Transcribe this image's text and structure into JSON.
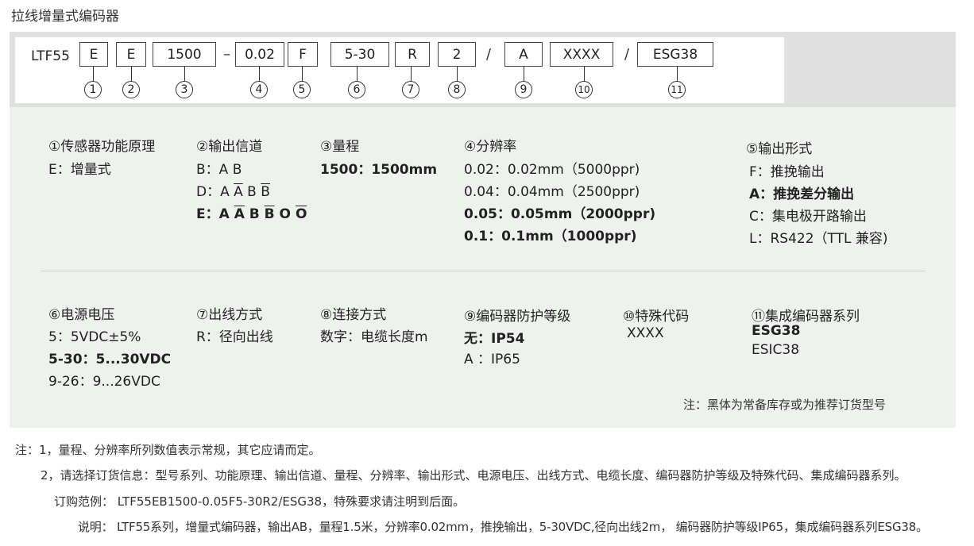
{
  "title": "拉线增量式编码器",
  "model": {
    "prefix": "LTF55",
    "boxes": [
      "E",
      "E",
      "1500",
      "0.02",
      "F",
      "5-30",
      "R",
      "2",
      "A",
      "XXXX",
      "ESG38"
    ],
    "dash": "–",
    "slash1": "/",
    "slash2": "/",
    "numbers": [
      "1",
      "2",
      "3",
      "4",
      "5",
      "6",
      "7",
      "8",
      "9",
      "10",
      "11"
    ]
  },
  "spec": {
    "c1": {
      "head": "①传感器功能原理",
      "l1": "E：增量式"
    },
    "c2": {
      "head": "②输出信道",
      "l1": "B：A B",
      "l2_pre": "D：A ",
      "l2_a": "A",
      "l2_mid": " B ",
      "l2_b": "B",
      "l3_pre": "E：A ",
      "l3_a": "A",
      "l3_mid": " B ",
      "l3_b": "B",
      "l3_mid2": " O ",
      "l3_o": "O"
    },
    "c3": {
      "head": "③量程",
      "l1": "1500：1500mm"
    },
    "c4": {
      "head": "④分辨率",
      "l1": "0.02：0.02mm（5000ppr)",
      "l2": "0.04：0.04mm（2500ppr)",
      "l3": "0.05：0.05mm（2000ppr)",
      "l4": "0.1：0.1mm（1000ppr)"
    },
    "c5": {
      "head": "⑤输出形式",
      "l1": "F：推挽输出",
      "l2": "A：推挽差分输出",
      "l3": "C：集电极开路输出",
      "l4": "L：RS422（TTL 兼容)"
    },
    "c6": {
      "head": "⑥电源电压",
      "l1": "5：5VDC±5%",
      "l2": "5-30：5...30VDC",
      "l3": "9-26：9...26VDC"
    },
    "c7": {
      "head": "⑦出线方式",
      "l1": "R：径向出线"
    },
    "c8": {
      "head": "⑧连接方式",
      "l1": "数字：电缆长度m"
    },
    "c9": {
      "head": "⑨编码器防护等级",
      "l1": "无：IP54",
      "l2": "A ：IP65"
    },
    "c10": {
      "head": "⑩特殊代码",
      "l1": "XXXX"
    },
    "c11": {
      "head": "⑪集成编码器系列",
      "l1": "ESG38",
      "l2": "ESIC38"
    },
    "footnote": "注：黑体为常备库存或为推荐订货型号"
  },
  "notes": {
    "n1": "注：1，量程、分辨率所列数值表示常规，其它应请而定。",
    "n2": "2，请选择订货信息：型号系列、功能原理、输出信道、量程、分辨率、输出形式、电源电压、出线方式、电缆长度、编码器防护等级及特殊代码、集成编码器系列。",
    "n3": "订购范例：  LTF55EB1500-0.05F5-30R2/ESG38，特殊要求请注明到后面。",
    "n4": "说明：  LTF55系列，增量式编码器，输出AB，量程1.5米，分辨率0.02mm，推挽输出，5-30VDC,径向出线2m， 编码器防护等级IP65，集成编码器系列ESG38。"
  }
}
